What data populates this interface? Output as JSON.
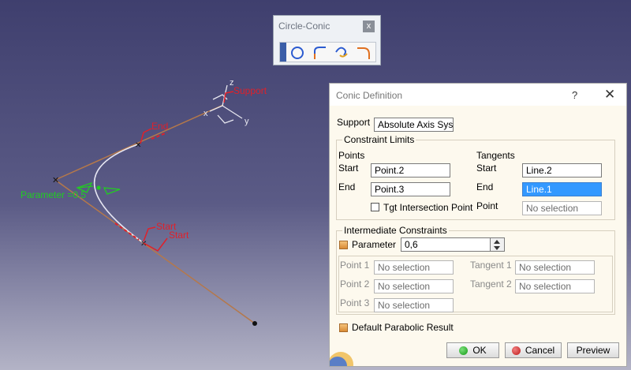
{
  "viewport": {
    "labels": {
      "support": "Support",
      "end": "End",
      "start1": "Start",
      "start2": "Start",
      "parameter": "Parameter =0.5",
      "axis_z": "z",
      "axis_x": "x",
      "axis_y": "y"
    }
  },
  "toolbar": {
    "title": "Circle-Conic",
    "close": "x",
    "buttons": [
      "circle-tool-icon",
      "corner-tool-icon",
      "connect-curve-tool-icon",
      "conic-tool-icon"
    ]
  },
  "dialog": {
    "title": "Conic Definition",
    "help": "?",
    "close": "✕",
    "support_label": "Support",
    "support_value": "Absolute Axis Syste",
    "constraint_limits": {
      "title": "Constraint Limits",
      "points_header": "Points",
      "tangents_header": "Tangents",
      "start_label": "Start",
      "end_label": "End",
      "point_label": "Point",
      "start_point": "Point.2",
      "end_point": "Point.3",
      "start_tangent": "Line.2",
      "end_tangent": "Line.1",
      "tangent_point": "No selection",
      "tgt_intersection_label": "Tgt Intersection Point"
    },
    "intermediate": {
      "title": "Intermediate Constraints",
      "parameter_label": "Parameter",
      "parameter_value": "0,6",
      "point1_label": "Point 1",
      "point2_label": "Point 2",
      "point3_label": "Point 3",
      "tangent1_label": "Tangent 1",
      "tangent2_label": "Tangent 2",
      "point1_value": "No selection",
      "point2_value": "No selection",
      "point3_value": "No selection",
      "tangent1_value": "No selection",
      "tangent2_value": "No selection"
    },
    "default_parabolic_label": "Default Parabolic Result",
    "buttons": {
      "ok": "OK",
      "cancel": "Cancel",
      "preview": "Preview"
    }
  },
  "colors": {
    "construction_line": "#b5784a",
    "conic_curve": "#e6e6f2",
    "annotation_red": "#e0202a",
    "parameter_green": "#22cc22",
    "selection_blue": "#3399ff"
  }
}
